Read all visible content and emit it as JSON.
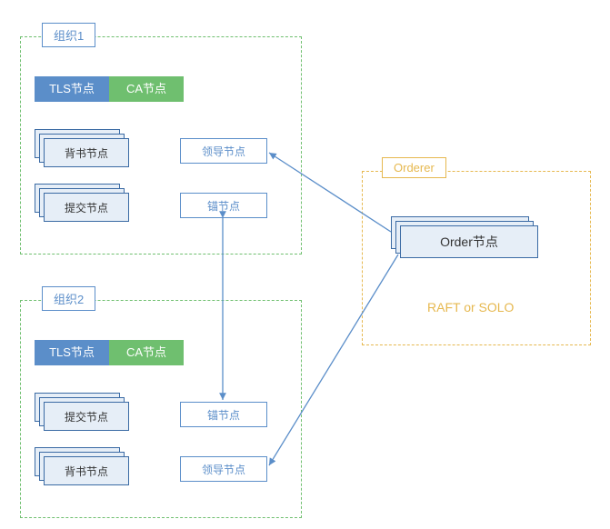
{
  "org1": {
    "title": "组织1",
    "tls": "TLS节点",
    "ca": "CA节点",
    "endorse": "背书节点",
    "commit": "提交节点",
    "leader": "领导节点",
    "anchor": "锚节点"
  },
  "org2": {
    "title": "组织2",
    "tls": "TLS节点",
    "ca": "CA节点",
    "commit": "提交节点",
    "endorse": "背书节点",
    "anchor": "锚节点",
    "leader": "领导节点"
  },
  "orderer": {
    "title": "Orderer",
    "node": "Order节点",
    "consensus": "RAFT or SOLO"
  }
}
